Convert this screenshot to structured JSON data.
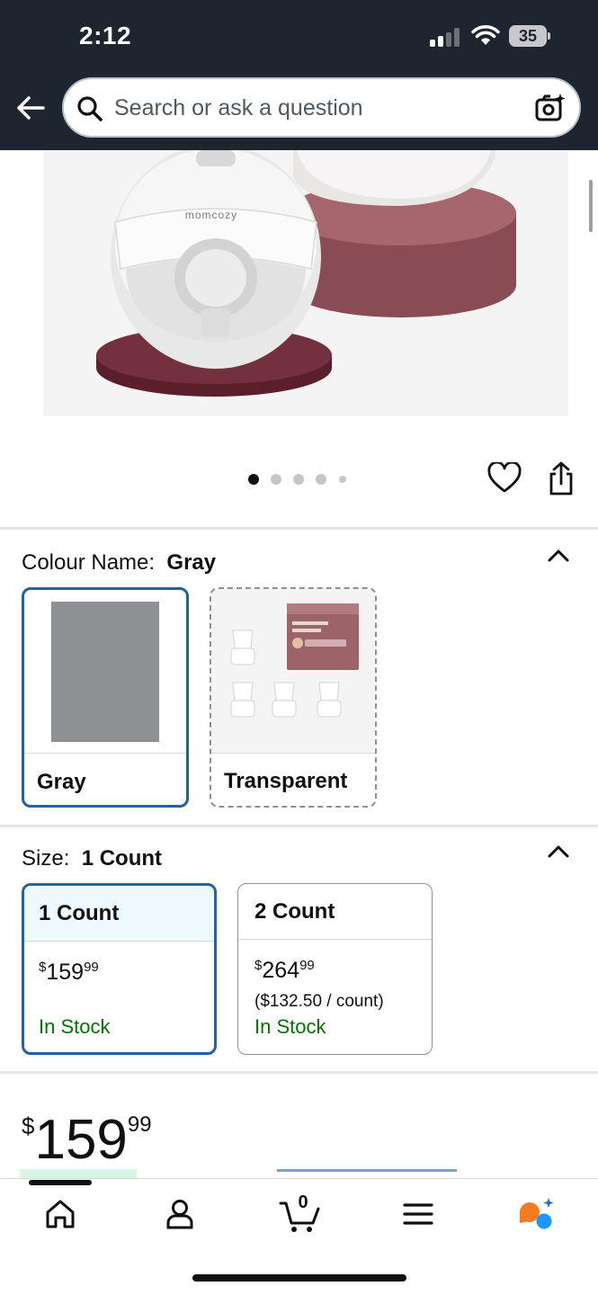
{
  "status_bar": {
    "time": "2:12",
    "battery": "35"
  },
  "header": {
    "search_placeholder": "Search or ask a question",
    "icons": [
      "back-arrow-icon",
      "search-icon",
      "camera-search-icon"
    ]
  },
  "product": {
    "brand_on_image": "momcozy",
    "image_count": 5,
    "active_image_index": 0
  },
  "colour": {
    "label": "Colour Name:",
    "selected": "Gray",
    "options": [
      {
        "label": "Gray",
        "selected": true,
        "swatch_color": "#8e9094"
      },
      {
        "label": "Transparent",
        "selected": false
      }
    ]
  },
  "size": {
    "label": "Size:",
    "selected": "1 Count",
    "options": [
      {
        "label": "1 Count",
        "price_symbol": "$",
        "price_whole": "159",
        "price_fraction": "99",
        "unit_price": "",
        "stock": "In Stock",
        "selected": true
      },
      {
        "label": "2 Count",
        "price_symbol": "$",
        "price_whole": "264",
        "price_fraction": "99",
        "unit_price": "($132.50 / count)",
        "stock": "In Stock",
        "selected": false
      }
    ]
  },
  "price": {
    "symbol": "$",
    "whole": "159",
    "fraction": "99"
  },
  "bottom_nav": {
    "items": [
      "home-icon",
      "account-icon",
      "cart-icon",
      "menu-icon",
      "rufus-assistant-icon"
    ],
    "cart_count": "0"
  },
  "colors": {
    "header_bg": "#1c2530",
    "selected_border": "#2162a1",
    "in_stock": "#007600",
    "accent_orange": "#f47b20",
    "accent_blue": "#1a98ff"
  }
}
